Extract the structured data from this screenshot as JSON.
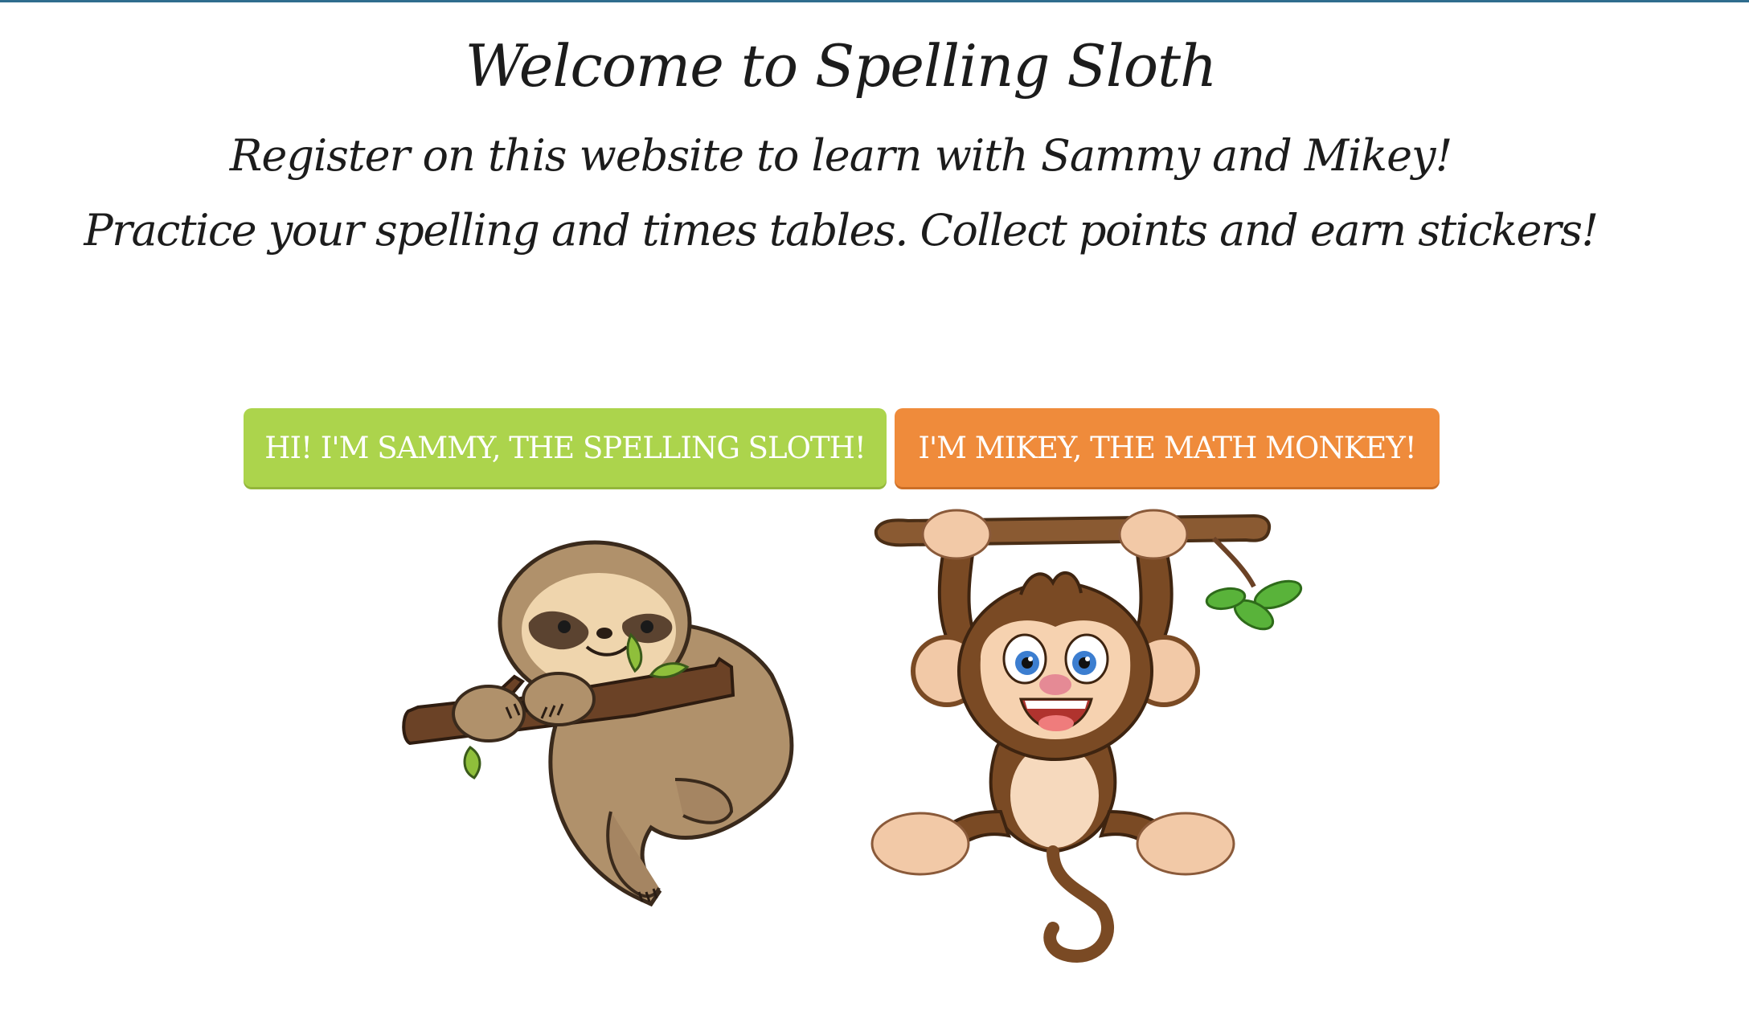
{
  "page": {
    "title": "Welcome to Spelling Sloth",
    "subtitle": "Register on this website to learn with Sammy and Mikey!",
    "tagline": "Practice your spelling and times tables. Collect points and earn stickers!"
  },
  "characters": {
    "sloth_button_label": "HI! I'M SAMMY, THE SPELLING SLOTH!",
    "monkey_button_label": "I'M MIKEY, THE MATH MONKEY!",
    "sloth_image": "sloth-on-branch-illustration",
    "monkey_image": "monkey-hanging-from-branch-illustration"
  },
  "colors": {
    "sloth_button": "#acd44c",
    "monkey_button": "#ef8b3b",
    "top_rule": "#2f6d8e"
  }
}
